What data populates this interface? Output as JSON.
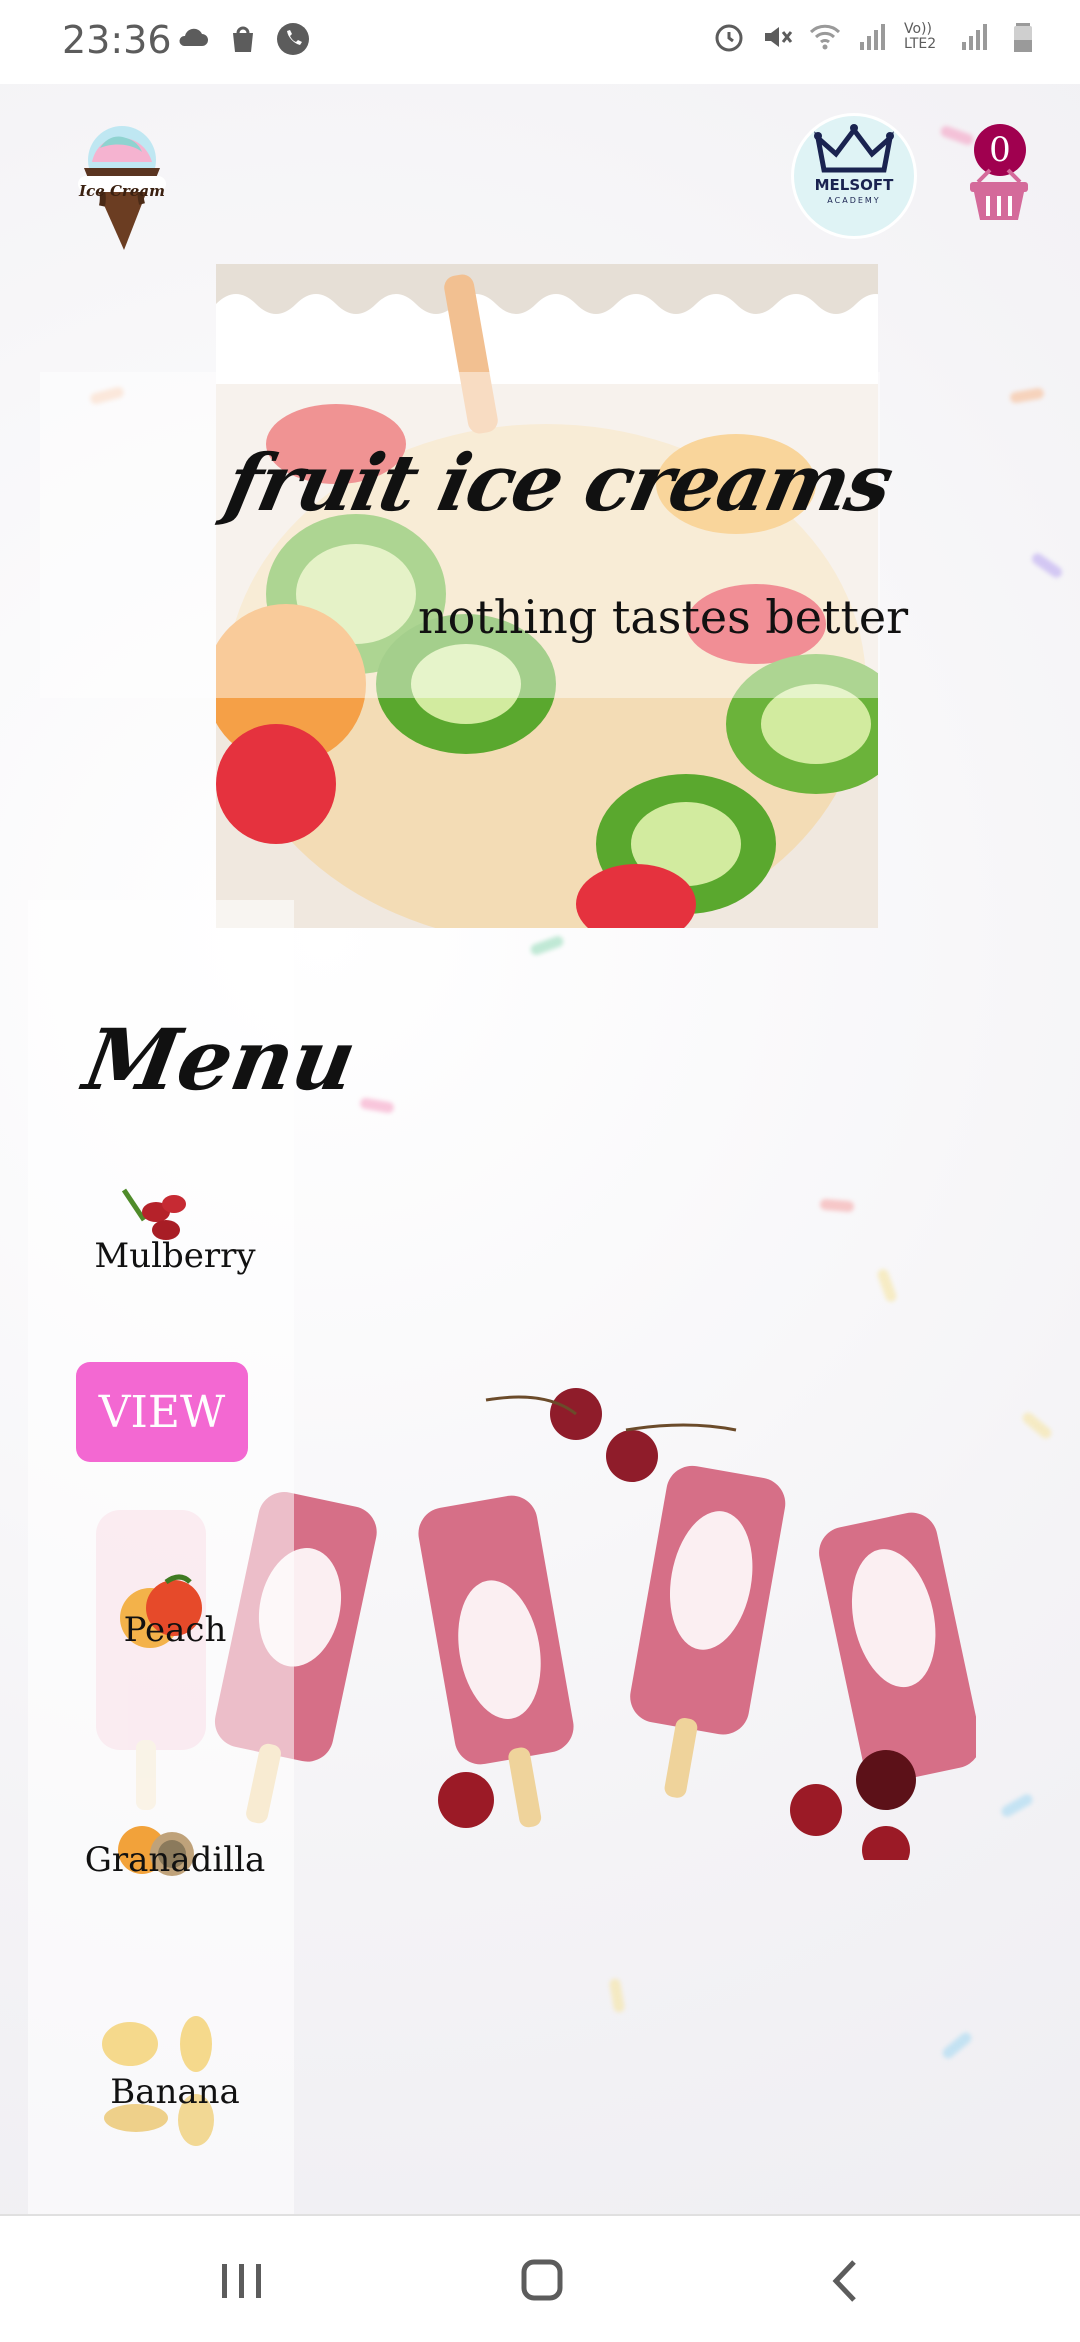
{
  "status_bar": {
    "time": "23:36",
    "network_label": "Vo)) LTE2"
  },
  "header": {
    "logo_text": "Ice Cream",
    "academy_text": "MELSOFT",
    "academy_sub": "ACADEMY",
    "cart_count": "0"
  },
  "hero": {
    "title": "fruit ice creams",
    "subtitle": "nothing tastes better"
  },
  "menu": {
    "title": "Menu",
    "items": [
      {
        "label": "Mulberry"
      },
      {
        "label": "Peach"
      },
      {
        "label": "Granadilla"
      },
      {
        "label": "Banana"
      }
    ],
    "view_label": "VIEW"
  },
  "colors": {
    "accent": "#f35ccf",
    "badge": "#a0004f",
    "cart": "#d46a9a"
  }
}
